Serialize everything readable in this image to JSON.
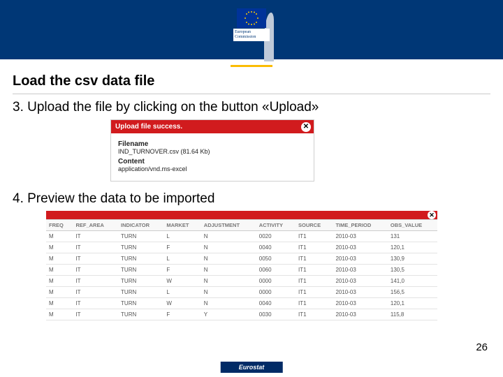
{
  "logo": {
    "line1": "European",
    "line2": "Commission"
  },
  "title": "Load the csv data file",
  "step3": "3. Upload the file by clicking on the button «Upload»",
  "upload": {
    "heading": "Upload file success.",
    "close": "✕",
    "filename_label": "Filename",
    "filename_value": "IND_TURNOVER.csv (81.64 Kb)",
    "content_label": "Content",
    "content_value": "application/vnd.ms-excel"
  },
  "step4": "4. Preview the data to be imported",
  "table": {
    "close": "✕",
    "headers": [
      "FREQ",
      "REF_AREA",
      "INDICATOR",
      "MARKET",
      "ADJUSTMENT",
      "ACTIVITY",
      "SOURCE",
      "TIME_PERIOD",
      "OBS_VALUE"
    ],
    "rows": [
      [
        "M",
        "IT",
        "TURN",
        "L",
        "N",
        "0020",
        "IT1",
        "2010-03",
        "131"
      ],
      [
        "M",
        "IT",
        "TURN",
        "F",
        "N",
        "0040",
        "IT1",
        "2010-03",
        "120,1"
      ],
      [
        "M",
        "IT",
        "TURN",
        "L",
        "N",
        "0050",
        "IT1",
        "2010-03",
        "130,9"
      ],
      [
        "M",
        "IT",
        "TURN",
        "F",
        "N",
        "0060",
        "IT1",
        "2010-03",
        "130,5"
      ],
      [
        "M",
        "IT",
        "TURN",
        "W",
        "N",
        "0000",
        "IT1",
        "2010-03",
        "141,0"
      ],
      [
        "M",
        "IT",
        "TURN",
        "L",
        "N",
        "0000",
        "IT1",
        "2010-03",
        "156,5"
      ],
      [
        "M",
        "IT",
        "TURN",
        "W",
        "N",
        "0040",
        "IT1",
        "2010-03",
        "120,1"
      ],
      [
        "M",
        "IT",
        "TURN",
        "F",
        "Y",
        "0030",
        "IT1",
        "2010-03",
        "115,8"
      ]
    ]
  },
  "page_number": "26",
  "footer": "Eurostat"
}
